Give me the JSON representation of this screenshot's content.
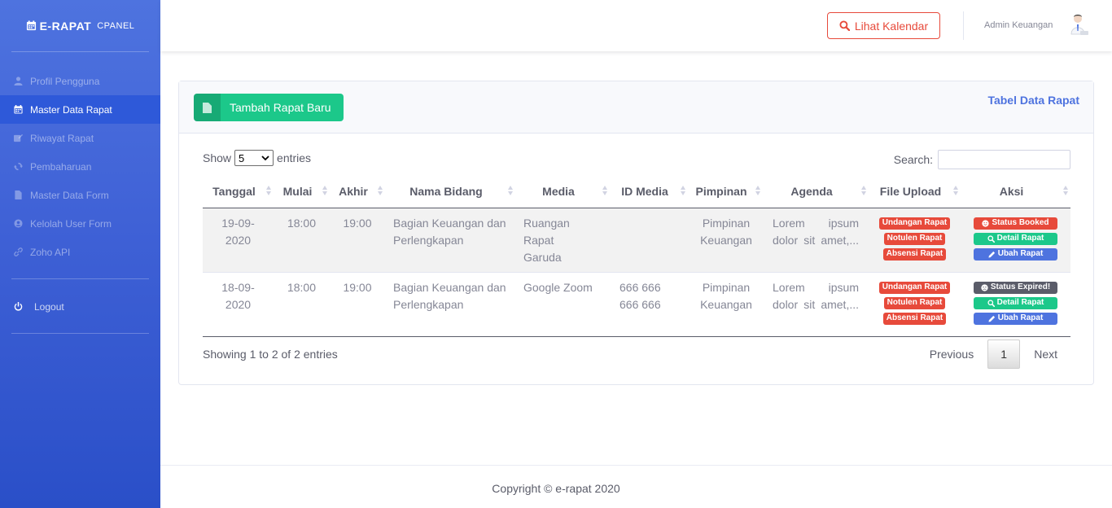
{
  "sidebar": {
    "brand_main": "E-RAPAT",
    "brand_sub": "CPANEL",
    "items": [
      {
        "label": "Profil Pengguna",
        "icon": "user-icon"
      },
      {
        "label": "Master Data Rapat",
        "icon": "calendar-icon",
        "active": true
      },
      {
        "label": "Riwayat Rapat",
        "icon": "edit-icon"
      },
      {
        "label": "Pembaharuan",
        "icon": "sync-icon"
      },
      {
        "label": "Master Data Form",
        "icon": "file-icon"
      },
      {
        "label": "Kelolah User Form",
        "icon": "user-circle-icon"
      },
      {
        "label": "Zoho API",
        "icon": "link-icon"
      }
    ],
    "logout": "Logout"
  },
  "topbar": {
    "calendar_button": "Lihat Kalendar",
    "username": "Admin Keuangan"
  },
  "card": {
    "add_button": "Tambah Rapat Baru",
    "title": "Tabel Data Rapat",
    "show_label": "Show",
    "entries_value": "5",
    "entries_label": "entries",
    "search_label": "Search:",
    "search_value": ""
  },
  "table": {
    "columns": [
      "Tanggal",
      "Mulai",
      "Akhir",
      "Nama Bidang",
      "Media",
      "ID Media",
      "Pimpinan",
      "Agenda",
      "File Upload",
      "Aksi"
    ],
    "rows": [
      {
        "tanggal_1": "19-09-",
        "tanggal_2": "2020",
        "mulai": "18:00",
        "akhir": "19:00",
        "bidang": "Bagian Keuangan dan Perlengkapan",
        "media": "Ruangan Rapat Garuda",
        "id_media": "",
        "pimpinan": "Pimpinan Keuangan",
        "agenda": "Lorem ipsum dolor sit amet,...",
        "files": [
          "Undangan Rapat",
          "Notulen Rapat",
          "Absensi Rapat"
        ],
        "status": "Status Booked",
        "detail": "Detail Rapat",
        "ubah": "Ubah Rapat"
      },
      {
        "tanggal_1": "18-09-",
        "tanggal_2": "2020",
        "mulai": "18:00",
        "akhir": "19:00",
        "bidang": "Bagian Keuangan dan Perlengkapan",
        "media": "Google Zoom",
        "id_media": "666 666 666 666",
        "pimpinan": "Pimpinan Keuangan",
        "agenda": "Lorem ipsum dolor sit amet,...",
        "files": [
          "Undangan Rapat",
          "Notulen Rapat",
          "Absensi Rapat"
        ],
        "status": "Status Expired!",
        "detail": "Detail Rapat",
        "ubah": "Ubah Rapat"
      }
    ]
  },
  "pagination": {
    "info": "Showing 1 to 2 of 2 entries",
    "previous": "Previous",
    "page": "1",
    "next": "Next"
  },
  "footer": "Copyright © e-rapat 2020",
  "colors": {
    "primary": "#4e73df",
    "success": "#1cc88a",
    "danger": "#e74a3b",
    "secondary": "#5a5c69"
  }
}
